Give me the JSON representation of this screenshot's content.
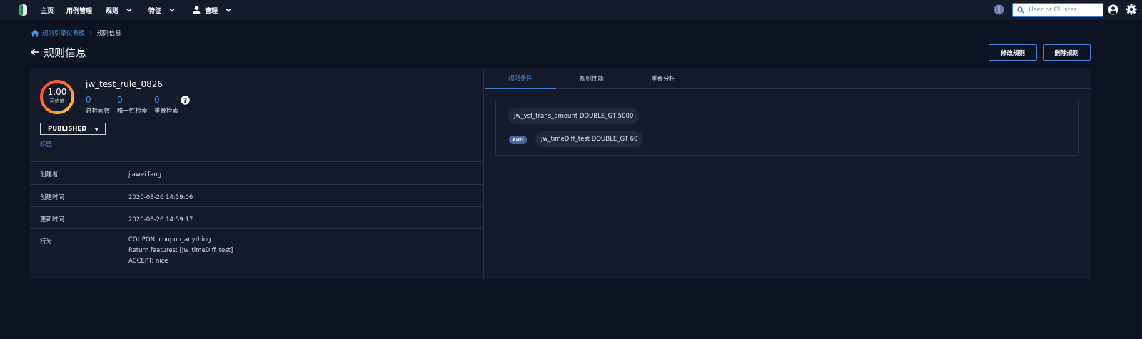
{
  "nav": {
    "items": [
      {
        "label": "主页"
      },
      {
        "label": "用例管理"
      },
      {
        "label": "规则"
      },
      {
        "label": "特征"
      },
      {
        "label": "管理"
      }
    ],
    "search_placeholder": "User or Cluster"
  },
  "breadcrumb": {
    "parent": "规则引擎仪表板",
    "separator": "›",
    "current": "规则信息"
  },
  "page": {
    "title": "规则信息",
    "edit_label": "修改规则",
    "delete_label": "删除规则"
  },
  "rule": {
    "confidence": "1.00",
    "confidence_label": "可信度",
    "name": "jw_test_rule_0826",
    "stats": [
      {
        "value": "0",
        "label": "总检索数"
      },
      {
        "value": "0",
        "label": "唯一性检索"
      },
      {
        "value": "0",
        "label": "重叠检索"
      }
    ],
    "status": "PUBLISHED",
    "tags_label": "标签",
    "details": [
      {
        "key": "创建者",
        "value": "jiawei.fang"
      },
      {
        "key": "创建时间",
        "value": "2020-08-26 14:59:06"
      },
      {
        "key": "更新时间",
        "value": "2020-08-26 14:59:17"
      }
    ],
    "action_key": "行为",
    "actions": [
      "COUPON: coupon_anything",
      "Return features: [jw_timeDiff_test]",
      "ACCEPT: nice"
    ]
  },
  "tabs": [
    {
      "label": "规则条件"
    },
    {
      "label": "规则性能"
    },
    {
      "label": "重叠分析"
    }
  ],
  "conditions": {
    "first": "jw_ysf_trans_amount DOUBLE_GT 5000",
    "operator": "AND",
    "second": "jw_timeDiff_test DOUBLE_GT 60"
  },
  "colors": {
    "accent": "#3c7fd8",
    "background": "#0e1422",
    "panel": "#151b2a"
  }
}
